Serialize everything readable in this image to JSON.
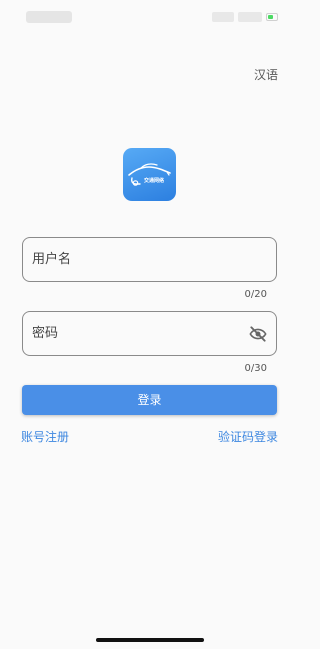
{
  "status_bar": {
    "battery_level": 0.5,
    "battery_color": "#4cd964"
  },
  "language_switch": {
    "label": "汉语"
  },
  "logo": {
    "icon": "car-icon",
    "text": "交通网络"
  },
  "username": {
    "placeholder": "用户名",
    "value": "",
    "counter": "0/20"
  },
  "password": {
    "placeholder": "密码",
    "value": "",
    "counter": "0/30",
    "visibility_icon": "eye-off-icon"
  },
  "login_button": {
    "label": "登录",
    "color": "#4a8fe7"
  },
  "links": {
    "register": "账号注册",
    "sms_login": "验证码登录",
    "color": "#3d87e0"
  }
}
